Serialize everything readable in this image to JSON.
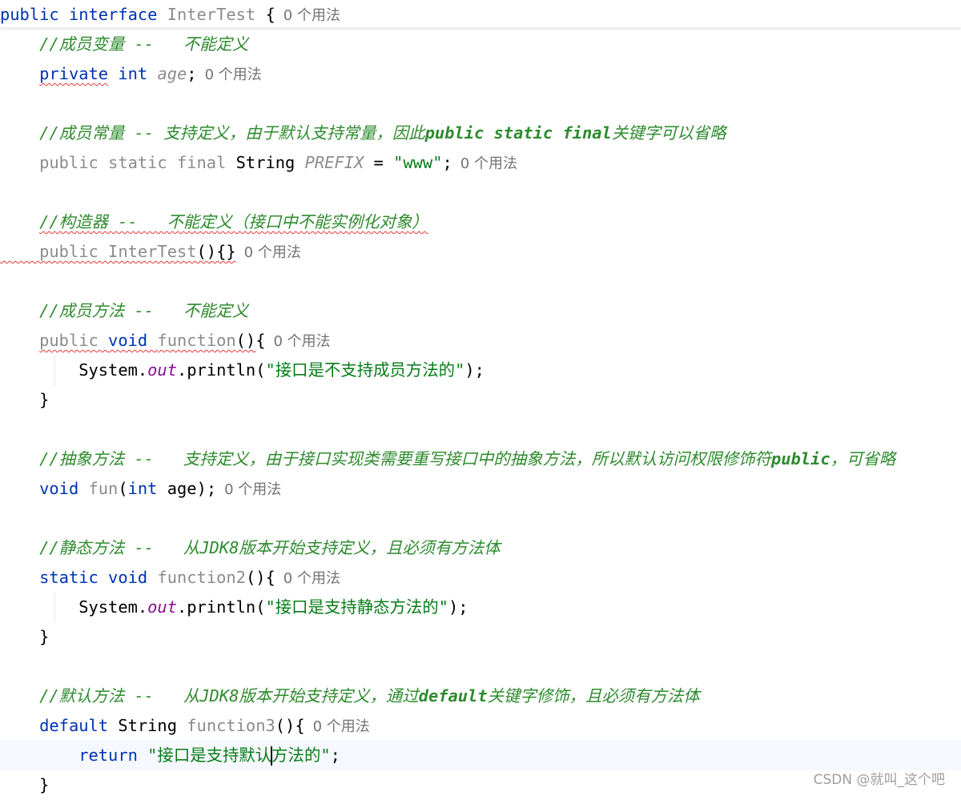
{
  "lines": [
    [
      {
        "t": "public ",
        "c": "kw"
      },
      {
        "t": "interface ",
        "c": "kw"
      },
      {
        "t": "InterTest",
        "c": "dim"
      },
      {
        "t": " {",
        "c": "cls"
      },
      {
        "t": "0 个用法",
        "c": "hint"
      }
    ],
    [
      {
        "t": "    //成员变量 --   不能定义",
        "c": "cmt"
      }
    ],
    [
      {
        "t": "    "
      },
      {
        "t": "private",
        "c": "kw",
        "w": 1
      },
      {
        "t": " int ",
        "c": "kw"
      },
      {
        "t": "age",
        "c": "const"
      },
      {
        "t": ";",
        "c": "cls"
      },
      {
        "t": "0 个用法",
        "c": "hint"
      }
    ],
    [],
    [
      {
        "t": "    //成员常量 -- 支持定义，由于默认支持常量，因此",
        "c": "cmt"
      },
      {
        "t": "public static final",
        "c": "cmt-b"
      },
      {
        "t": "关键字可以省略",
        "c": "cmt"
      }
    ],
    [
      {
        "t": "    public static final ",
        "c": "dim"
      },
      {
        "t": "String ",
        "c": "cls"
      },
      {
        "t": "PREFIX",
        "c": "const"
      },
      {
        "t": " = ",
        "c": "cls"
      },
      {
        "t": "\"www\"",
        "c": "str"
      },
      {
        "t": ";",
        "c": "cls"
      },
      {
        "t": "0 个用法",
        "c": "hint"
      }
    ],
    [],
    [
      {
        "t": "    "
      },
      {
        "t": "//构造器 --   不能定义（接口中不能实例化对象）",
        "c": "cmt",
        "w": 1
      }
    ],
    [
      {
        "t": "    ",
        "w": 1
      },
      {
        "t": "public InterTest",
        "c": "dim",
        "w": 1
      },
      {
        "t": "(){}",
        "c": "cls",
        "w": 1
      },
      {
        "t": "0 个用法",
        "c": "hint"
      }
    ],
    [],
    [
      {
        "t": "    //成员方法 --   不能定义",
        "c": "cmt"
      }
    ],
    [
      {
        "t": "    "
      },
      {
        "t": "public ",
        "c": "dim",
        "w": 1
      },
      {
        "t": "void ",
        "c": "kw",
        "w": 1
      },
      {
        "t": "function",
        "c": "dim",
        "w": 1
      },
      {
        "t": "()",
        "c": "cls",
        "w": 1
      },
      {
        "t": "{",
        "c": "cls"
      },
      {
        "t": "0 个用法",
        "c": "hint"
      }
    ],
    [
      {
        "t": "        System.",
        "c": "cls"
      },
      {
        "t": "out",
        "c": "static-f"
      },
      {
        "t": ".println(",
        "c": "cls"
      },
      {
        "t": "\"接口是不支持成员方法的\"",
        "c": "str"
      },
      {
        "t": ");",
        "c": "cls"
      }
    ],
    [
      {
        "t": "    }",
        "c": "cls"
      }
    ],
    [],
    [
      {
        "t": "    //抽象方法 --   支持定义，由于接口实现类需要重写接口中的抽象方法，所以默认访问权限修饰符",
        "c": "cmt"
      },
      {
        "t": "public",
        "c": "cmt-b"
      },
      {
        "t": "，可省略",
        "c": "cmt"
      }
    ],
    [
      {
        "t": "    "
      },
      {
        "t": "void ",
        "c": "kw"
      },
      {
        "t": "fun",
        "c": "dim"
      },
      {
        "t": "(",
        "c": "cls"
      },
      {
        "t": "int ",
        "c": "kw"
      },
      {
        "t": "age);",
        "c": "cls"
      },
      {
        "t": "0 个用法",
        "c": "hint"
      }
    ],
    [],
    [
      {
        "t": "    //静态方法 --   从JDK8版本开始支持定义，且必须有方法体",
        "c": "cmt"
      }
    ],
    [
      {
        "t": "    "
      },
      {
        "t": "static void ",
        "c": "kw"
      },
      {
        "t": "function2",
        "c": "dim"
      },
      {
        "t": "(){",
        "c": "cls"
      },
      {
        "t": "0 个用法",
        "c": "hint"
      }
    ],
    [
      {
        "t": "        System.",
        "c": "cls"
      },
      {
        "t": "out",
        "c": "static-f"
      },
      {
        "t": ".println(",
        "c": "cls"
      },
      {
        "t": "\"接口是支持静态方法的\"",
        "c": "str"
      },
      {
        "t": ");",
        "c": "cls"
      }
    ],
    [
      {
        "t": "    }",
        "c": "cls"
      }
    ],
    [],
    [
      {
        "t": "    //默认方法 --   从JDK8版本开始支持定义，通过",
        "c": "cmt"
      },
      {
        "t": "default",
        "c": "cmt-b"
      },
      {
        "t": "关键字修饰，且必须有方法体",
        "c": "cmt"
      }
    ],
    [
      {
        "t": "    "
      },
      {
        "t": "default ",
        "c": "kw"
      },
      {
        "t": "String ",
        "c": "cls"
      },
      {
        "t": "function3",
        "c": "dim"
      },
      {
        "t": "(){",
        "c": "cls"
      },
      {
        "t": "0 个用法",
        "c": "hint"
      }
    ],
    [
      {
        "t": "        "
      },
      {
        "t": "return ",
        "c": "kw"
      },
      {
        "t": "\"接口是支持默认",
        "c": "str"
      },
      {
        "t": "",
        "c": "caret"
      },
      {
        "t": "方法的\"",
        "c": "str"
      },
      {
        "t": ";",
        "c": "cls"
      }
    ],
    [
      {
        "t": "    }",
        "c": "cls"
      }
    ]
  ],
  "watermark": "CSDN @就叫_这个吧"
}
